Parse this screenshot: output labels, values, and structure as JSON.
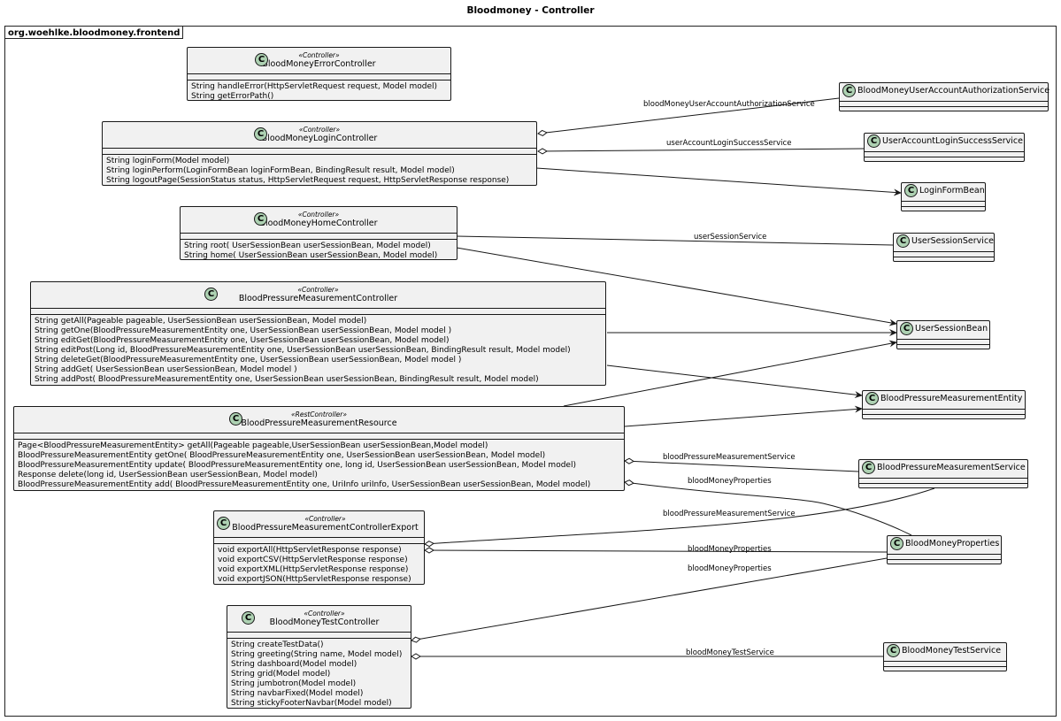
{
  "diagram": {
    "title": "Bloodmoney - Controller"
  },
  "package": {
    "name": "org.woehlke.bloodmoney.frontend"
  },
  "classes": {
    "error_ctrl": {
      "stereotype": "«Controller»",
      "name": "BloodMoneyErrorController",
      "icon": "C",
      "methods": [
        "String handleError(HttpServletRequest request, Model model)",
        "String getErrorPath()"
      ]
    },
    "login_ctrl": {
      "stereotype": "«Controller»",
      "name": "BloodMoneyLoginController",
      "icon": "C",
      "methods": [
        "String loginForm(Model model)",
        "String loginPerform(LoginFormBean loginFormBean, BindingResult result, Model model)",
        "String logoutPage(SessionStatus status, HttpServletRequest request, HttpServletResponse response)"
      ]
    },
    "home_ctrl": {
      "stereotype": "«Controller»",
      "name": "BloodMoneyHomeController",
      "icon": "C",
      "methods": [
        "String root( UserSessionBean userSessionBean, Model model)",
        "String home( UserSessionBean userSessionBean, Model model)"
      ]
    },
    "bpm_ctrl": {
      "stereotype": "«Controller»",
      "name": "BloodPressureMeasurementController",
      "icon": "C",
      "methods": [
        "String getAll(Pageable pageable, UserSessionBean userSessionBean, Model model)",
        "String getOne(BloodPressureMeasurementEntity one, UserSessionBean userSessionBean, Model model )",
        "String editGet(BloodPressureMeasurementEntity one, UserSessionBean userSessionBean, Model model)",
        "String editPost(Long id, BloodPressureMeasurementEntity one, UserSessionBean userSessionBean, BindingResult result, Model model)",
        "String deleteGet(BloodPressureMeasurementEntity one, UserSessionBean userSessionBean, Model model )",
        "String addGet( UserSessionBean userSessionBean, Model model )",
        "String addPost( BloodPressureMeasurementEntity one, UserSessionBean userSessionBean, BindingResult result, Model model)"
      ]
    },
    "bpm_res": {
      "stereotype": "«RestController»",
      "name": "BloodPressureMeasurementResource",
      "icon": "C",
      "methods": [
        "Page<BloodPressureMeasurementEntity> getAll(Pageable pageable,UserSessionBean userSessionBean,Model model)",
        "BloodPressureMeasurementEntity getOne( BloodPressureMeasurementEntity one, UserSessionBean userSessionBean, Model model)",
        "BloodPressureMeasurementEntity update( BloodPressureMeasurementEntity one, long id, UserSessionBean userSessionBean, Model model)",
        "Response delete(long id, UserSessionBean userSessionBean, Model model)",
        "BloodPressureMeasurementEntity add( BloodPressureMeasurementEntity one, UriInfo uriInfo, UserSessionBean userSessionBean, Model model)"
      ]
    },
    "bpm_export": {
      "stereotype": "«Controller»",
      "name": "BloodPressureMeasurementControllerExport",
      "icon": "C",
      "methods": [
        "void exportAll(HttpServletResponse response)",
        "void exportCSV(HttpServletResponse response)",
        "void exportXML(HttpServletResponse response)",
        "void exportJSON(HttpServletResponse response)"
      ]
    },
    "test_ctrl": {
      "stereotype": "«Controller»",
      "name": "BloodMoneyTestController",
      "icon": "C",
      "methods": [
        "String createTestData()",
        "String greeting(String name, Model model)",
        "String dashboard(Model model)",
        "String grid(Model model)",
        "String jumbotron(Model model)",
        "String navbarFixed(Model model)",
        "String stickyFooterNavbar(Model model)"
      ]
    },
    "auth_svc": {
      "name": "BloodMoneyUserAccountAuthorizationService",
      "icon": "C"
    },
    "login_success_svc": {
      "name": "UserAccountLoginSuccessService",
      "icon": "C"
    },
    "login_form_bean": {
      "name": "LoginFormBean",
      "icon": "C"
    },
    "user_session_svc": {
      "name": "UserSessionService",
      "icon": "C"
    },
    "user_session_bean": {
      "name": "UserSessionBean",
      "icon": "C"
    },
    "bpm_entity": {
      "name": "BloodPressureMeasurementEntity",
      "icon": "C"
    },
    "bpm_svc": {
      "name": "BloodPressureMeasurementService",
      "icon": "C"
    },
    "props": {
      "name": "BloodMoneyProperties",
      "icon": "C"
    },
    "test_svc": {
      "name": "BloodMoneyTestService",
      "icon": "C"
    }
  },
  "edges": [
    {
      "from": "login_ctrl",
      "to": "auth_svc",
      "kind": "aggregation",
      "label": "bloodMoneyUserAccountAuthorizationService"
    },
    {
      "from": "login_ctrl",
      "to": "login_success_svc",
      "kind": "aggregation",
      "label": "userAccountLoginSuccessService"
    },
    {
      "from": "login_ctrl",
      "to": "login_form_bean",
      "kind": "dependency",
      "label": ""
    },
    {
      "from": "home_ctrl",
      "to": "user_session_svc",
      "kind": "association",
      "label": "userSessionService"
    },
    {
      "from": "home_ctrl",
      "to": "user_session_bean",
      "kind": "dependency",
      "label": ""
    },
    {
      "from": "bpm_ctrl",
      "to": "user_session_bean",
      "kind": "dependency",
      "label": ""
    },
    {
      "from": "bpm_ctrl",
      "to": "bpm_entity",
      "kind": "dependency",
      "label": ""
    },
    {
      "from": "bpm_res",
      "to": "user_session_bean",
      "kind": "dependency",
      "label": ""
    },
    {
      "from": "bpm_res",
      "to": "bpm_entity",
      "kind": "dependency",
      "label": ""
    },
    {
      "from": "bpm_res",
      "to": "bpm_svc",
      "kind": "aggregation",
      "label": "bloodPressureMeasurementService"
    },
    {
      "from": "bpm_res",
      "to": "props",
      "kind": "aggregation",
      "label": "bloodMoneyProperties"
    },
    {
      "from": "bpm_export",
      "to": "bpm_svc",
      "kind": "aggregation",
      "label": "bloodPressureMeasurementService"
    },
    {
      "from": "bpm_export",
      "to": "props",
      "kind": "aggregation",
      "label": "bloodMoneyProperties"
    },
    {
      "from": "test_ctrl",
      "to": "props",
      "kind": "aggregation",
      "label": "bloodMoneyProperties"
    },
    {
      "from": "test_ctrl",
      "to": "test_svc",
      "kind": "aggregation",
      "label": "bloodMoneyTestService"
    }
  ]
}
